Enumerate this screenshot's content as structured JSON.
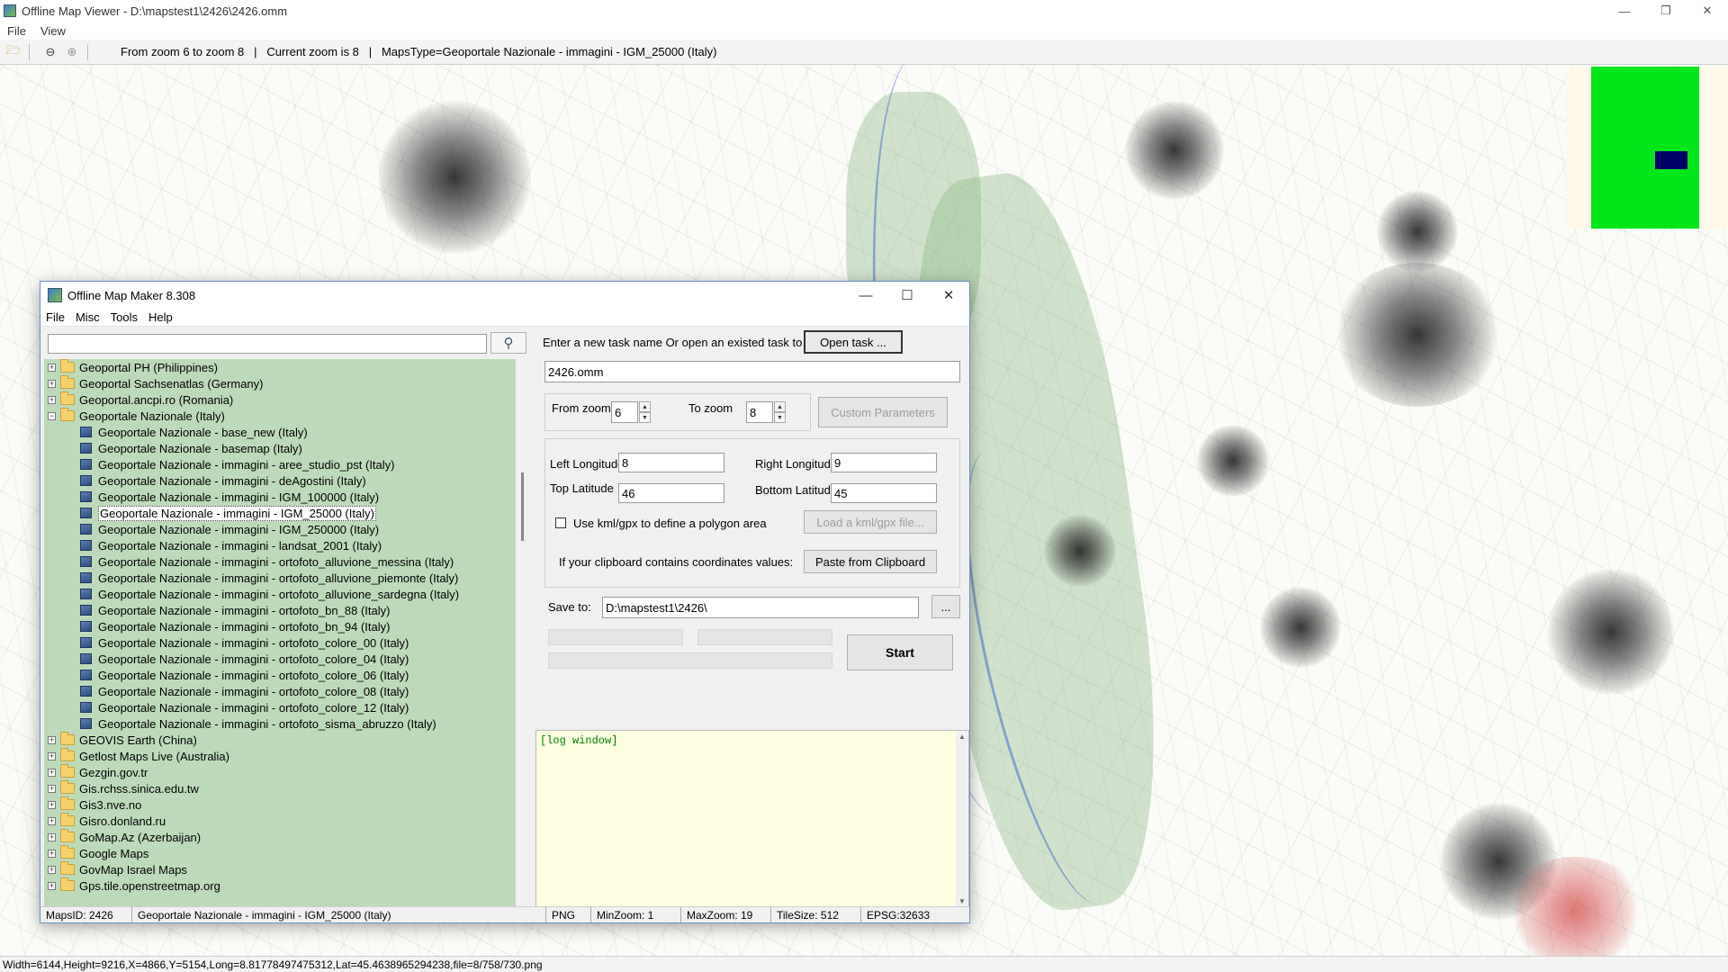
{
  "viewer": {
    "title": "Offline Map Viewer - D:\\mapstest1\\2426\\2426.omm",
    "menu": [
      "File",
      "View"
    ],
    "toolbar_info": "From zoom 6 to zoom 8   |   Current zoom is 8   |   MapsType=Geoportale Nazionale - immagini - IGM_25000 (Italy)",
    "status": "Width=6144,Height=9216,X=4866,Y=5154,Long=8.81778497475312,Lat=45.4638965294238,file=8/758/730.png"
  },
  "dialog": {
    "title": "Offline Map Maker 8.308",
    "menu": [
      "File",
      "Misc",
      "Tools",
      "Help"
    ],
    "search": {
      "value": "",
      "placeholder": ""
    },
    "tree": [
      {
        "type": "folder",
        "label": "Geoportal PH (Philippines)",
        "expander": "+"
      },
      {
        "type": "folder",
        "label": "Geoportal Sachsenatlas (Germany)",
        "expander": "+"
      },
      {
        "type": "folder",
        "label": "Geoportal.ancpi.ro (Romania)",
        "expander": "+"
      },
      {
        "type": "folder",
        "label": "Geoportale Nazionale (Italy)",
        "expander": "−",
        "open": true
      },
      {
        "type": "child",
        "label": "Geoportale Nazionale - base_new (Italy)"
      },
      {
        "type": "child",
        "label": "Geoportale Nazionale - basemap (Italy)"
      },
      {
        "type": "child",
        "label": "Geoportale Nazionale - immagini - aree_studio_pst (Italy)"
      },
      {
        "type": "child",
        "label": "Geoportale Nazionale - immagini - deAgostini (Italy)"
      },
      {
        "type": "child",
        "label": "Geoportale Nazionale - immagini - IGM_100000 (Italy)"
      },
      {
        "type": "child",
        "label": "Geoportale Nazionale - immagini - IGM_25000 (Italy)",
        "selected": true
      },
      {
        "type": "child",
        "label": "Geoportale Nazionale - immagini - IGM_250000 (Italy)"
      },
      {
        "type": "child",
        "label": "Geoportale Nazionale - immagini - landsat_2001 (Italy)"
      },
      {
        "type": "child",
        "label": "Geoportale Nazionale - immagini - ortofoto_alluvione_messina (Italy)"
      },
      {
        "type": "child",
        "label": "Geoportale Nazionale - immagini - ortofoto_alluvione_piemonte (Italy)"
      },
      {
        "type": "child",
        "label": "Geoportale Nazionale - immagini - ortofoto_alluvione_sardegna (Italy)"
      },
      {
        "type": "child",
        "label": "Geoportale Nazionale - immagini - ortofoto_bn_88 (Italy)"
      },
      {
        "type": "child",
        "label": "Geoportale Nazionale - immagini - ortofoto_bn_94 (Italy)"
      },
      {
        "type": "child",
        "label": "Geoportale Nazionale - immagini - ortofoto_colore_00 (Italy)"
      },
      {
        "type": "child",
        "label": "Geoportale Nazionale - immagini - ortofoto_colore_04 (Italy)"
      },
      {
        "type": "child",
        "label": "Geoportale Nazionale - immagini - ortofoto_colore_06 (Italy)"
      },
      {
        "type": "child",
        "label": "Geoportale Nazionale - immagini - ortofoto_colore_08 (Italy)"
      },
      {
        "type": "child",
        "label": "Geoportale Nazionale - immagini - ortofoto_colore_12 (Italy)"
      },
      {
        "type": "child",
        "label": "Geoportale Nazionale - immagini - ortofoto_sisma_abruzzo (Italy)"
      },
      {
        "type": "folder",
        "label": "GEOVIS Earth (China)",
        "expander": "+"
      },
      {
        "type": "folder",
        "label": "Getlost Maps Live (Australia)",
        "expander": "+"
      },
      {
        "type": "folder",
        "label": "Gezgin.gov.tr",
        "expander": "+"
      },
      {
        "type": "folder",
        "label": "Gis.rchss.sinica.edu.tw",
        "expander": "+"
      },
      {
        "type": "folder",
        "label": "Gis3.nve.no",
        "expander": "+"
      },
      {
        "type": "folder",
        "label": "Gisro.donland.ru",
        "expander": "+"
      },
      {
        "type": "folder",
        "label": "GoMap.Az (Azerbaijan)",
        "expander": "+"
      },
      {
        "type": "folder",
        "label": "Google Maps",
        "expander": "+"
      },
      {
        "type": "folder",
        "label": "GovMap Israel Maps",
        "expander": "+"
      },
      {
        "type": "folder",
        "label": "Gps.tile.openstreetmap.org",
        "expander": "+"
      }
    ],
    "task": {
      "prompt": "Enter a new task name Or open an existed task to continue:",
      "open_button": "Open task ...",
      "name": "2426.omm"
    },
    "zoom": {
      "from_label": "From zoom",
      "from_value": "6",
      "to_label": "To zoom",
      "to_value": "8",
      "custom_button": "Custom Parameters"
    },
    "coords": {
      "left_lon_label": "Left Longitude",
      "left_lon": "8",
      "right_lon_label": "Right Longitude",
      "right_lon": "9",
      "top_lat_label": "Top Latitude",
      "top_lat": "46",
      "bottom_lat_label": "Bottom Latitude",
      "bottom_lat": "45",
      "kml_label": "Use kml/gpx to define a polygon area",
      "kml_button": "Load a kml/gpx file...",
      "clipboard_label": "If your clipboard contains coordinates values:",
      "clipboard_button": "Paste from Clipboard"
    },
    "save": {
      "label": "Save to:",
      "path": "D:\\mapstest1\\2426\\",
      "browse": "..."
    },
    "start_button": "Start",
    "log": "[log window]",
    "status": {
      "maps_id": "MapsID: 2426",
      "maps_type": "Geoportale Nazionale - immagini - IGM_25000 (Italy)",
      "format": "PNG",
      "min_zoom": "MinZoom: 1",
      "max_zoom": "MaxZoom: 19",
      "tile_size": "TileSize: 512",
      "epsg": "EPSG:32633"
    }
  }
}
